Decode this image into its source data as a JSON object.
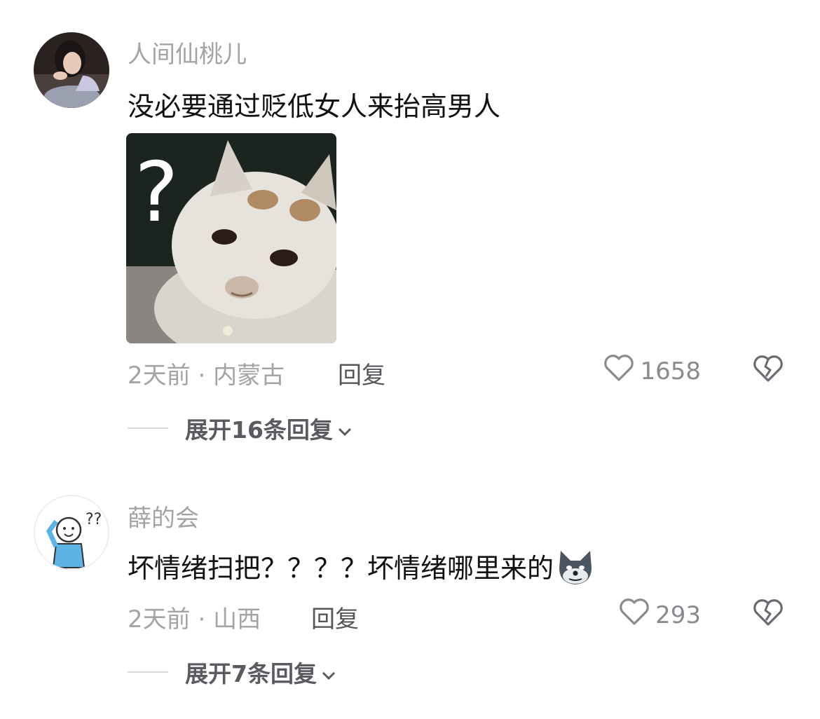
{
  "comments": [
    {
      "username": "人间仙桃儿",
      "text": "没必要通过贬低女人来抬高男人",
      "time": "2天前",
      "separator": "·",
      "location": "内蒙古",
      "reply_label": "回复",
      "likes": "1658",
      "expand_label": "展开16条回复",
      "has_sticker": true,
      "sticker_icon": "confused-cat-question-sticker"
    },
    {
      "username": "薛的会",
      "text": "坏情绪扫把？？？？坏情绪哪里来的",
      "trailing_emoji": "wolf-face-emoji",
      "time": "2天前",
      "separator": "·",
      "location": "山西",
      "reply_label": "回复",
      "likes": "293",
      "expand_label": "展开7条回复"
    }
  ],
  "icons": {
    "like": "heart-outline-icon",
    "dislike": "broken-heart-icon",
    "expand": "chevron-down-icon"
  }
}
